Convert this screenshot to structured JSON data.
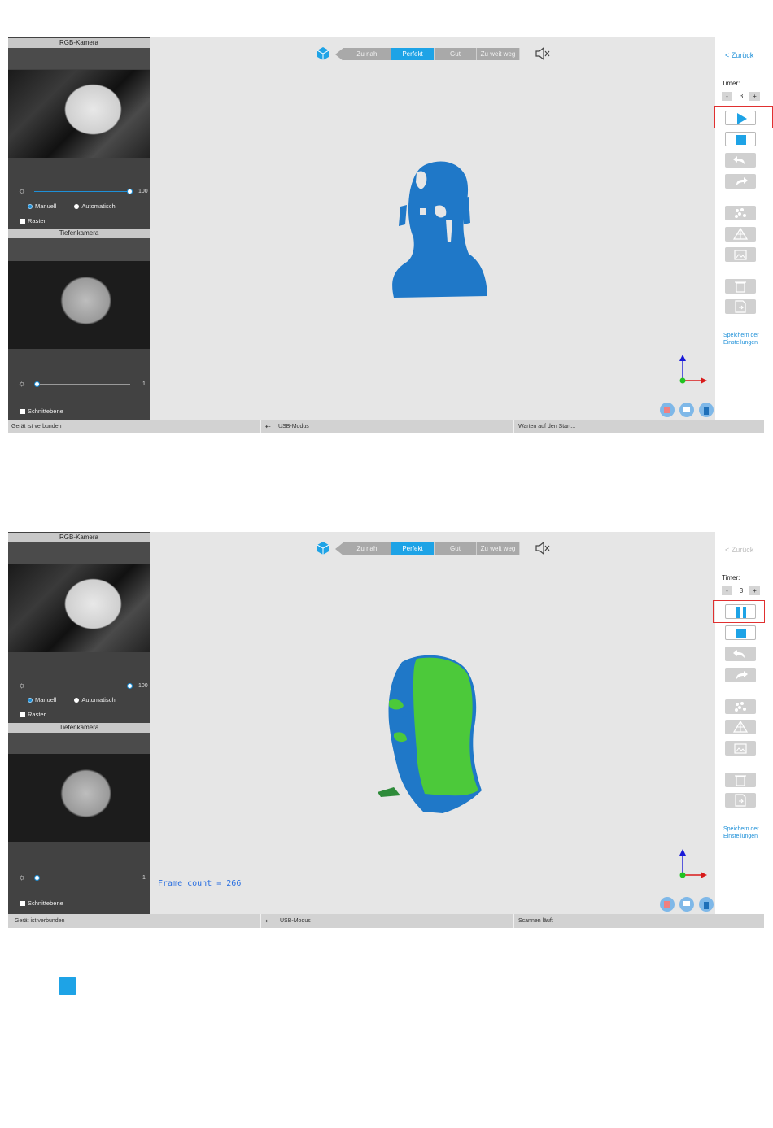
{
  "screens": [
    {
      "left_panel": {
        "rgb_header": "RGB-Kamera",
        "rgb_brightness": "100",
        "rgb_brightness_level": 1.0,
        "mode_manual": "Manuell",
        "mode_auto": "Automatisch",
        "raster_label": "Raster",
        "depth_header": "Tiefenkamera",
        "depth_brightness": "1",
        "depth_brightness_level": 0.0,
        "cutplane_label": "Schnittebene"
      },
      "distance_bar": [
        "Zu nah",
        "Perfekt",
        "Gut",
        "Zu weit weg"
      ],
      "distance_active": "Perfekt",
      "frame_count": "",
      "right_panel": {
        "back_label": "< Zurück",
        "timer_label": "Timer:",
        "timer_minus": "-",
        "timer_value": "3",
        "timer_plus": "+",
        "primary_control": "play",
        "save_settings": "Speichern der Einstellungen"
      },
      "status": {
        "connection": "Gerät ist verbunden",
        "usb_mode": "USB-Modus",
        "scan_state": "Warten auf den Start..."
      }
    },
    {
      "left_panel": {
        "rgb_header": "RGB-Kamera",
        "rgb_brightness": "100",
        "rgb_brightness_level": 1.0,
        "mode_manual": "Manuell",
        "mode_auto": "Automatisch",
        "raster_label": "Raster",
        "depth_header": "Tiefenkamera",
        "depth_brightness": "1",
        "depth_brightness_level": 0.0,
        "cutplane_label": "Schnittebene"
      },
      "distance_bar": [
        "Zu nah",
        "Perfekt",
        "Gut",
        "Zu weit weg"
      ],
      "distance_active": "Perfekt",
      "frame_count": "Frame count = 266",
      "right_panel": {
        "back_label": "< Zurück",
        "timer_label": "Timer:",
        "timer_minus": "-",
        "timer_value": "3",
        "timer_plus": "+",
        "primary_control": "pause",
        "save_settings": "Speichern der Einstellungen"
      },
      "status": {
        "connection": "Gerät ist verbunden",
        "usb_mode": "USB-Modus",
        "scan_state": "Scannen läuft"
      }
    }
  ],
  "colors": {
    "accent": "#1ea3e6",
    "highlight": "#e03030",
    "scan_blue": "#1f78c8",
    "scan_green": "#4cc93a"
  },
  "icons": [
    "cube-icon",
    "mute-icon",
    "sun-icon",
    "play-icon",
    "pause-icon",
    "stop-icon",
    "undo-icon",
    "redo-icon",
    "point-cloud-icon",
    "mesh-icon",
    "texture-icon",
    "delete-icon",
    "export-icon",
    "axes-icon",
    "usb-icon",
    "cloud-icon"
  ]
}
